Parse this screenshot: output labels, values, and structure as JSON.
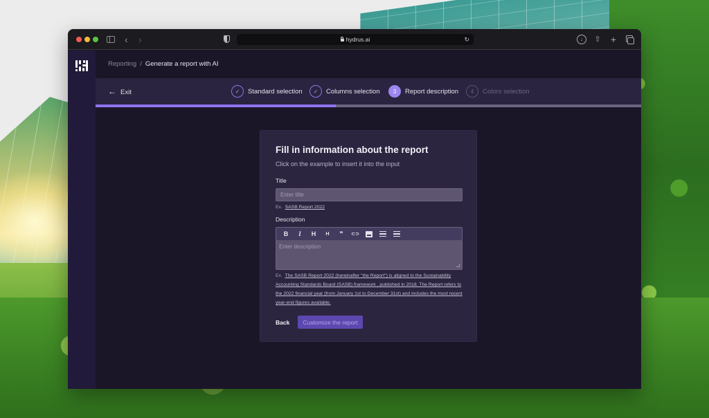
{
  "browser": {
    "url": "hydrus.ai",
    "icons": {
      "sidebar": "sidebar-toggle-icon",
      "back": "chevron-left-icon",
      "forward": "chevron-right-icon",
      "privacy": "shield-icon",
      "lock": "lock-icon",
      "reload": "reload-icon",
      "download": "download-icon",
      "share": "share-icon",
      "new_tab": "plus-icon",
      "tabs": "tabs-overview-icon"
    },
    "glyphs": {
      "back": "‹",
      "forward": "›",
      "reload": "↻",
      "download": "↓",
      "share": "⇧",
      "new_tab": "+"
    }
  },
  "app": {
    "breadcrumb": {
      "parent": "Reporting",
      "separator": "/",
      "current": "Generate a report with AI"
    },
    "exit": {
      "arrow": "←",
      "label": "Exit"
    },
    "steps": [
      {
        "number": "1",
        "label": "Standard selection",
        "state": "done",
        "glyph": "✓"
      },
      {
        "number": "2",
        "label": "Columns selection",
        "state": "done",
        "glyph": "✓"
      },
      {
        "number": "3",
        "label": "Report description",
        "state": "active",
        "glyph": "3"
      },
      {
        "number": "4",
        "label": "Colors selection",
        "state": "pending",
        "glyph": "4"
      }
    ],
    "progress_percent": 44,
    "colors": {
      "accent": "#8f74f0",
      "primary_button": "#5d48b0",
      "background": "#1b1627",
      "card": "#2c2540"
    }
  },
  "form": {
    "title": "Fill in information about the report",
    "subtitle": "Click on the example to insert it into the input",
    "title_field": {
      "label": "Title",
      "placeholder": "Enter title",
      "value": "",
      "example_prefix": "Ex.",
      "example": "SASB Report 2022"
    },
    "description_field": {
      "label": "Description",
      "placeholder": "Enter description",
      "value": "",
      "toolbar": [
        {
          "name": "bold",
          "glyph": "B"
        },
        {
          "name": "italic",
          "glyph": "I"
        },
        {
          "name": "heading-large",
          "glyph": "H"
        },
        {
          "name": "heading-small",
          "glyph": "H"
        },
        {
          "name": "quote",
          "glyph": "❞"
        },
        {
          "name": "link",
          "glyph": "⊂⊃"
        },
        {
          "name": "image",
          "glyph": ""
        },
        {
          "name": "bullet-list",
          "glyph": ""
        },
        {
          "name": "numbered-list",
          "glyph": ""
        }
      ],
      "example_prefix": "Ex.",
      "example": "The SASB Report 2022 (hereinafter \"the Report\") is aligned to the Sustainability Accounting Standards Board (SASB) framework , published in 2018. The Report refers to the 2022 financial year (from January 1st to December 31st) and includes the most recent year-end figures available."
    },
    "back_label": "Back",
    "submit_label": "Customize the report"
  }
}
